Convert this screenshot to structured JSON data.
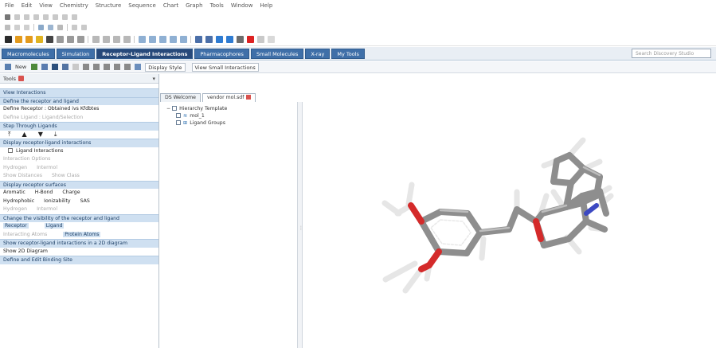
{
  "menu": [
    "File",
    "Edit",
    "View",
    "Chemistry",
    "Structure",
    "Sequence",
    "Chart",
    "Graph",
    "Tools",
    "Window",
    "Help"
  ],
  "ribbon_tabs": [
    "Macromolecules",
    "Simulation",
    "Receptor-Ligand Interactions",
    "Pharmacophores",
    "Small Molecules",
    "X-ray",
    "My Tools"
  ],
  "active_ribbon_tab": "Receptor-Ligand Interactions",
  "ribbon_search_placeholder": "Search Discovery Studio",
  "ribbon_bar": {
    "new_label": "New",
    "display_style_label": "Display Style",
    "view_interactions_label": "View Small Interactions"
  },
  "tools_panel": {
    "title": "Tools",
    "sections": {
      "s1_header": "View Interactions",
      "s1_sub": "Define the receptor and ligand",
      "s1_a": "Define Receptor : Obtained ivs Kfdbtes",
      "s1_b": "Define Ligand : Ligand/Selection",
      "s1_c": "Step Through Ligands",
      "s2_header": "Display receptor-ligand interactions",
      "s2_check": "Ligand Interactions",
      "s2_dim": "Interaction Options",
      "s2_a": "Hydrogen",
      "s2_b": "Intermol",
      "s2_c": "Show Distances",
      "s2_d": "Show Class",
      "s3_header": "Display receptor surfaces",
      "s3_cols": [
        "Aromatic",
        "H-Bond",
        "Charge"
      ],
      "s3_cols2": [
        "Hydrophobic",
        "Ionizability",
        "SAS"
      ],
      "s3_dim": [
        "Hydrogen",
        "Intermol"
      ],
      "s4_header": "Change the visibility of the receptor and ligand",
      "s4_row1": [
        "Receptor",
        "Ligand"
      ],
      "s4_row2": [
        "Interacting Atoms",
        "Protein Atoms"
      ],
      "s5_header": "Show receptor-ligand interactions in a 2D diagram",
      "s5_item": "Show 2D Diagram",
      "s6_header": "Define and Edit Binding Site"
    }
  },
  "document_tabs": [
    {
      "label": "DS Welcome",
      "active": false
    },
    {
      "label": "vendor mol.sdf",
      "active": true
    }
  ],
  "tree": {
    "root": "Hierarchy Template",
    "child1": "mol_1",
    "child2": "Ligand Groups"
  },
  "colors": {
    "ribbon_blue": "#3f6fa8",
    "section_blue": "#cfe0f1",
    "atom_oxygen": "#d42a2a",
    "atom_nitrogen": "#3c49c2",
    "bond_carbon": "#9a9a9a",
    "bond_hydrogen": "#e8e8e8"
  }
}
